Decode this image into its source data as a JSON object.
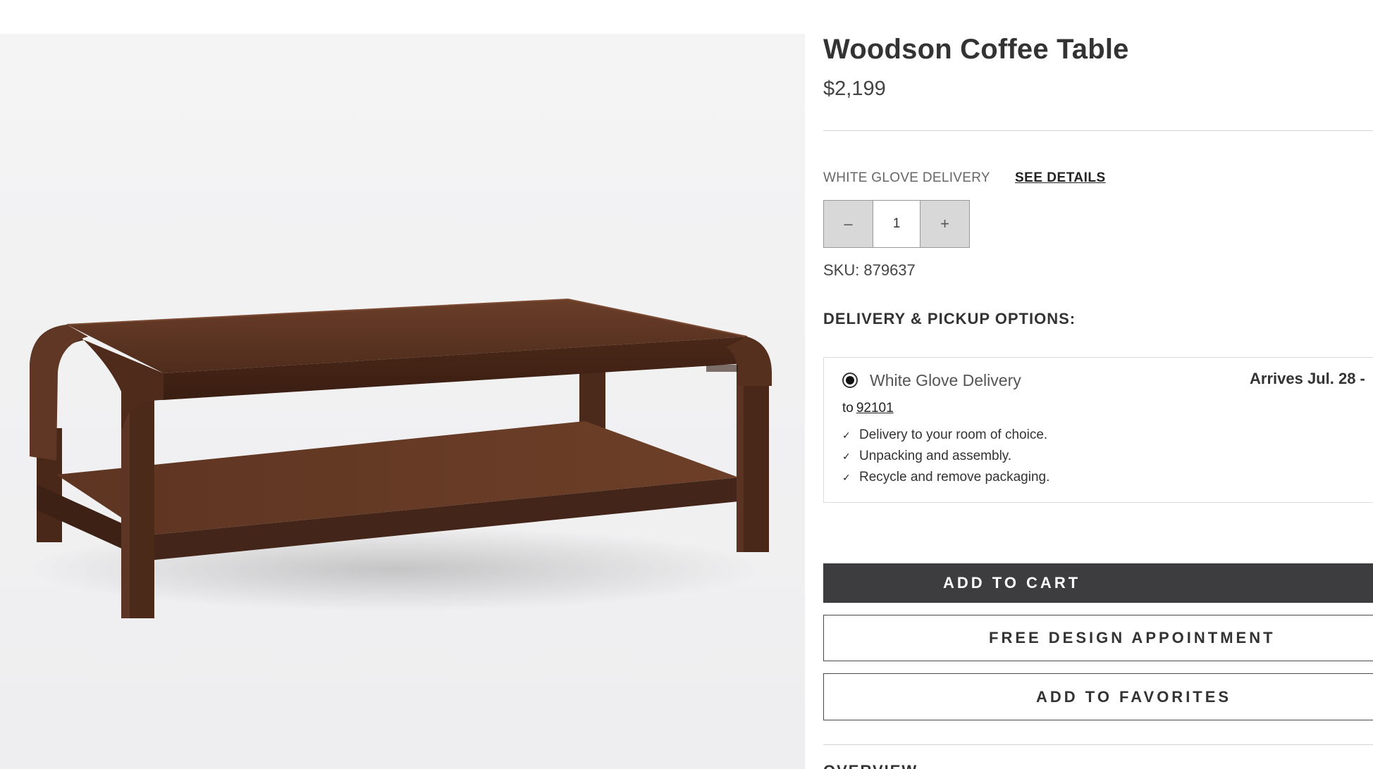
{
  "product": {
    "title": "Woodson Coffee Table",
    "price": "$2,199",
    "image_alt": "Walnut rectangular coffee table with lower shelf"
  },
  "delivery": {
    "type_label": "WHITE GLOVE DELIVERY",
    "see_details_label": "SEE DETAILS"
  },
  "quantity": {
    "minus_symbol": "–",
    "value": "1",
    "plus_symbol": "+"
  },
  "sku": {
    "label": "SKU:",
    "number": "879637"
  },
  "options": {
    "heading": "DELIVERY & PICKUP OPTIONS:",
    "selected_option": "White Glove Delivery",
    "arrival": "Arrives Jul. 28 -",
    "to_label": "to",
    "zip": "92101",
    "features": [
      "Delivery to your room of choice.",
      "Unpacking and assembly.",
      "Recycle and remove packaging."
    ],
    "check_symbol": "✓"
  },
  "buttons": {
    "add_to_cart": "ADD TO CART",
    "design_appointment": "FREE DESIGN APPOINTMENT",
    "add_to_favorites": "ADD TO FAVORITES"
  },
  "overview": {
    "heading": "OVERVIEW"
  },
  "colors": {
    "primary_button": "#3d3d3f",
    "wood": "#5b3422",
    "text": "#333333"
  }
}
